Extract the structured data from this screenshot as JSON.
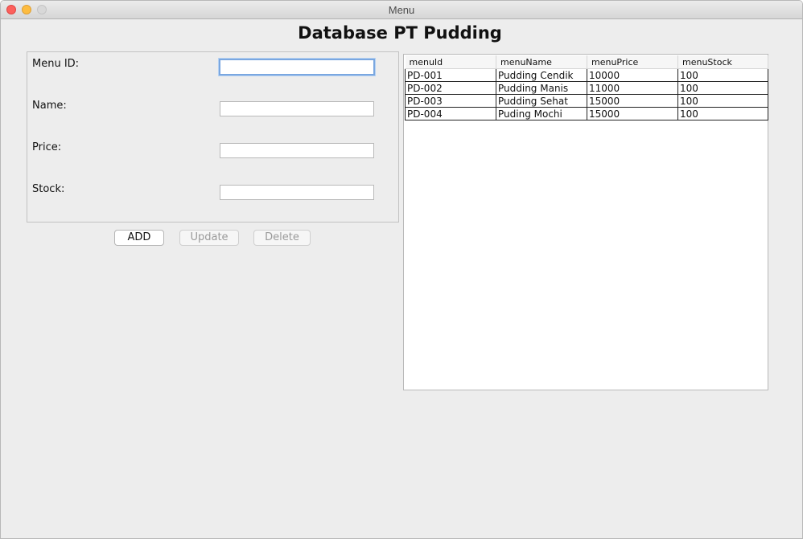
{
  "window": {
    "title": "Menu"
  },
  "heading": "Database PT Pudding",
  "form": {
    "fields": [
      {
        "label": "Menu ID:",
        "value": ""
      },
      {
        "label": "Name:",
        "value": ""
      },
      {
        "label": "Price:",
        "value": ""
      },
      {
        "label": "Stock:",
        "value": ""
      }
    ]
  },
  "buttons": {
    "add": "ADD",
    "update": "Update",
    "delete": "Delete"
  },
  "table": {
    "columns": [
      "menuId",
      "menuName",
      "menuPrice",
      "menuStock"
    ],
    "rows": [
      [
        "PD-001",
        "Pudding Cendik",
        "10000",
        "100"
      ],
      [
        "PD-002",
        "Pudding Manis",
        "11000",
        "100"
      ],
      [
        "PD-003",
        "Pudding Sehat",
        "15000",
        "100"
      ],
      [
        "PD-004",
        "Puding Mochi",
        "15000",
        "100"
      ]
    ]
  }
}
